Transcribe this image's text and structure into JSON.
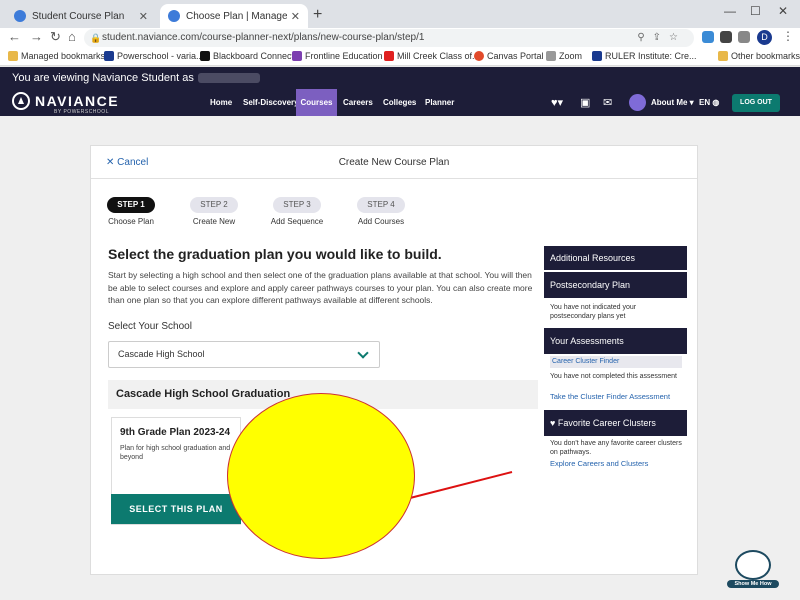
{
  "browser": {
    "tabs": [
      {
        "label": "Student Course Plan",
        "active": false
      },
      {
        "label": "Choose Plan | Manage Course Pl",
        "active": true
      }
    ],
    "url": "student.naviance.com/course-planner-next/plans/new-course-plan/step/1",
    "profile_initial": "D",
    "bookmarks": [
      "Managed bookmarks",
      "Powerschool - varia...",
      "Blackboard Connect",
      "Frontline Education",
      "Mill Creek Class of...",
      "Canvas Portal",
      "Zoom",
      "RULER Institute: Cre...",
      "Other bookmarks"
    ]
  },
  "naviance": {
    "viewing_text": "You are viewing Naviance Student as",
    "logo_text": "NAVIANCE",
    "logo_sub": "BY POWERSCHOOL",
    "nav": [
      "Home",
      "Self-Discovery",
      "Courses",
      "Careers",
      "Colleges",
      "Planner"
    ],
    "active_nav": "Courses",
    "about_me": "About Me",
    "lang": "EN",
    "logout": "LOG OUT"
  },
  "card": {
    "cancel": "Cancel",
    "title": "Create New Course Plan",
    "steps": [
      {
        "label": "STEP 1",
        "sub": "Choose Plan",
        "active": true
      },
      {
        "label": "STEP 2",
        "sub": "Create New",
        "active": false
      },
      {
        "label": "STEP 3",
        "sub": "Add Sequence",
        "active": false
      },
      {
        "label": "STEP 4",
        "sub": "Add Courses",
        "active": false
      }
    ],
    "heading": "Select the graduation plan you would like to build.",
    "description": "Start by selecting a high school and then select one of the graduation plans available at that school. You will then be able to select courses and explore and apply career pathways courses to your plan. You can also create more than one plan so that you can explore different pathways available at different schools.",
    "school_label": "Select Your School",
    "school_value": "Cascade High School",
    "plans_heading": "Cascade High School Graduation",
    "plan": {
      "title": "9th Grade Plan 2023-24",
      "desc": "Plan for high school graduation and beyond",
      "button": "SELECT THIS PLAN"
    }
  },
  "sidebar": {
    "additional": "Additional Resources",
    "postsecondary": "Postsecondary Plan",
    "postsecondary_text": "You have not indicated your postsecondary plans yet",
    "assessments": "Your Assessments",
    "cluster_finder": "Career Cluster Finder",
    "assessments_text": "You have not completed this assessment",
    "take_assessment": "Take the Cluster Finder Assessment",
    "favorites": "Favorite Career Clusters",
    "favorites_text": "You don't have any favorite career clusters on pathways.",
    "explore": "Explore Careers and Clusters"
  },
  "showme": "Show Me How",
  "colors": {
    "navy": "#1d1d38",
    "teal": "#0c7a6f",
    "purple": "#7c5fc0",
    "overlay_yellow": "#ffff00",
    "overlay_red": "#dd1111"
  }
}
